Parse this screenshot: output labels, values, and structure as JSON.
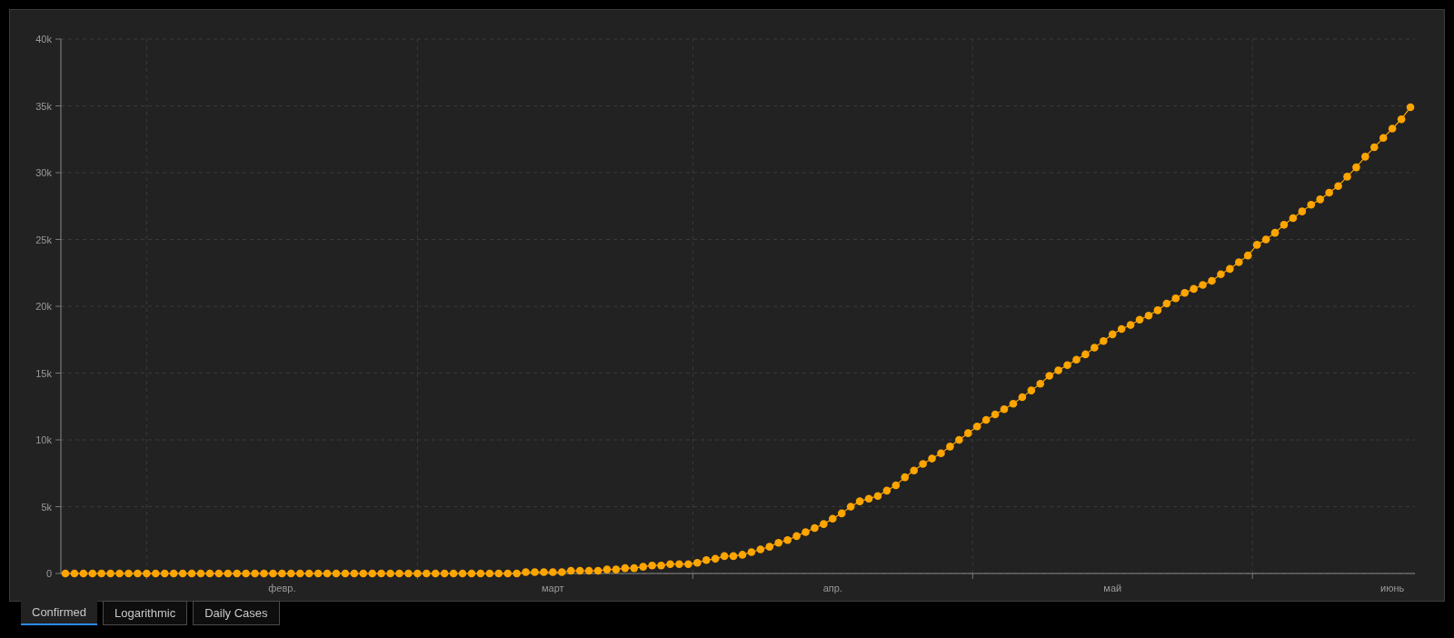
{
  "chart_data": {
    "type": "line",
    "categories": [
      null,
      null,
      null,
      null,
      null,
      null,
      null,
      null,
      null,
      null,
      null,
      null,
      null,
      null,
      null,
      null,
      null,
      null,
      null,
      null,
      null,
      null,
      null,
      null,
      "февр.",
      null,
      null,
      null,
      null,
      null,
      null,
      null,
      null,
      null,
      null,
      null,
      null,
      null,
      null,
      null,
      null,
      null,
      null,
      null,
      null,
      null,
      null,
      null,
      null,
      null,
      null,
      null,
      null,
      null,
      "март",
      null,
      null,
      null,
      null,
      null,
      null,
      null,
      null,
      null,
      null,
      null,
      null,
      null,
      null,
      null,
      null,
      null,
      null,
      null,
      null,
      null,
      null,
      null,
      null,
      null,
      null,
      null,
      null,
      null,
      null,
      "апр.",
      null,
      null,
      null,
      null,
      null,
      null,
      null,
      null,
      null,
      null,
      null,
      null,
      null,
      null,
      null,
      null,
      null,
      null,
      null,
      null,
      null,
      null,
      null,
      null,
      null,
      null,
      null,
      null,
      null,
      null,
      "май",
      null,
      null,
      null,
      null,
      null,
      null,
      null,
      null,
      null,
      null,
      null,
      null,
      null,
      null,
      null,
      null,
      null,
      null,
      null,
      null,
      null,
      null,
      null,
      null,
      null,
      null,
      null,
      null,
      null,
      null,
      "июнь",
      null,
      null
    ],
    "series": [
      {
        "color": "#ffa500",
        "marker": "circle",
        "values": [
          0,
          0,
          0,
          0,
          0,
          0,
          0,
          0,
          0,
          0,
          0,
          0,
          0,
          0,
          0,
          0,
          0,
          0,
          0,
          0,
          0,
          0,
          0,
          0,
          0,
          0,
          0,
          0,
          0,
          0,
          0,
          0,
          0,
          0,
          0,
          0,
          0,
          0,
          0,
          0,
          0,
          0,
          0,
          0,
          0,
          0,
          0,
          0,
          0,
          0,
          0,
          100,
          100,
          100,
          100,
          100,
          200,
          200,
          200,
          200,
          300,
          300,
          400,
          400,
          500,
          600,
          600,
          700,
          700,
          700,
          800,
          1000,
          1100,
          1300,
          1300,
          1400,
          1600,
          1800,
          2000,
          2300,
          2500,
          2800,
          3100,
          3400,
          3700,
          4100,
          4500,
          5000,
          5400,
          5600,
          5800,
          6200,
          6600,
          7200,
          7700,
          8200,
          8600,
          9000,
          9500,
          10000,
          10500,
          11000,
          11500,
          11900,
          12300,
          12700,
          13200,
          13700,
          14200,
          14800,
          15200,
          15600,
          16000,
          16400,
          16900,
          17400,
          17900,
          18300,
          18600,
          19000,
          19300,
          19700,
          20200,
          20600,
          21000,
          21300,
          21600,
          21900,
          22400,
          22800,
          23300,
          23800,
          24600,
          25000,
          25500,
          26100,
          26600,
          27100,
          27600,
          28000,
          28500,
          29000,
          29700,
          30400,
          31200,
          31900,
          32600,
          33300,
          34000,
          34900
        ]
      }
    ],
    "ylim": [
      0,
      40000
    ],
    "grid": true,
    "yticks": [
      {
        "value": 0,
        "label": "0"
      },
      {
        "value": 5000,
        "label": "5k"
      },
      {
        "value": 10000,
        "label": "10k"
      },
      {
        "value": 15000,
        "label": "15k"
      },
      {
        "value": 20000,
        "label": "20k"
      },
      {
        "value": 25000,
        "label": "25k"
      },
      {
        "value": 30000,
        "label": "30k"
      },
      {
        "value": 35000,
        "label": "35k"
      },
      {
        "value": 40000,
        "label": "40k"
      }
    ]
  },
  "tabs": [
    {
      "label": "Confirmed",
      "selected": true
    },
    {
      "label": "Logarithmic",
      "selected": false
    },
    {
      "label": "Daily Cases",
      "selected": false
    }
  ]
}
